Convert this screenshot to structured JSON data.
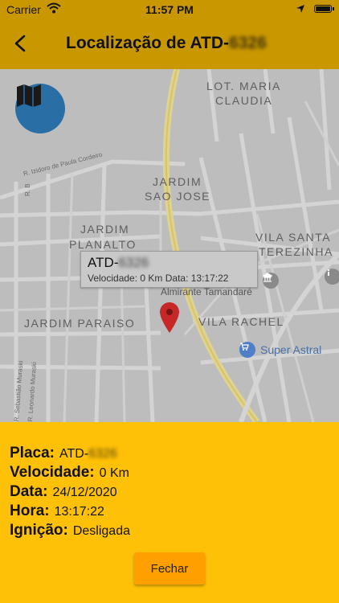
{
  "status_bar": {
    "carrier": "Carrier",
    "time": "11:57 PM"
  },
  "app_bar": {
    "title_prefix": "Localização de ATD-",
    "title_plate_masked": "6326"
  },
  "map": {
    "neighborhoods": [
      "LOT. MARIA",
      "CLAUDIA",
      "JARDIM",
      "SAO JOSE",
      "JARDIM",
      "PLANALTO",
      "VILA SANTA",
      "TEREZINHA",
      "JARDIM PARAISO",
      "VILA RACHEL"
    ],
    "streets": {
      "izidoro": "R. Izidoro de Paula Cordeiro",
      "r_b": "R. B",
      "muraski": "R. Sebastião Muraski",
      "leonardo": "R. Leonardo Muraski"
    },
    "poi": {
      "tamandare": "Almirante Tamandaré",
      "super_astral": "Super Astral"
    },
    "callout": {
      "plate_prefix": "ATD-",
      "plate_masked": "6326",
      "subtitle": "Velocidade: 0 Km Data: 13:17:22"
    },
    "layers_icon": "map-icon"
  },
  "info": {
    "plate_label": "Placa:",
    "plate_prefix": "ATD-",
    "plate_masked": "6326",
    "speed_label": "Velocidade:",
    "speed_value": "0 Km",
    "date_label": "Data:",
    "date_value": "24/12/2020",
    "time_label": "Hora:",
    "time_value": "13:17:22",
    "ignition_label": "Ignição:",
    "ignition_value": "Desligada",
    "close_label": "Fechar"
  },
  "colors": {
    "app_bar": "#c99700",
    "panel": "#ffc107",
    "button": "#ff9f00",
    "map_pin": "#c62828",
    "layers_button": "#2a6ea6"
  }
}
